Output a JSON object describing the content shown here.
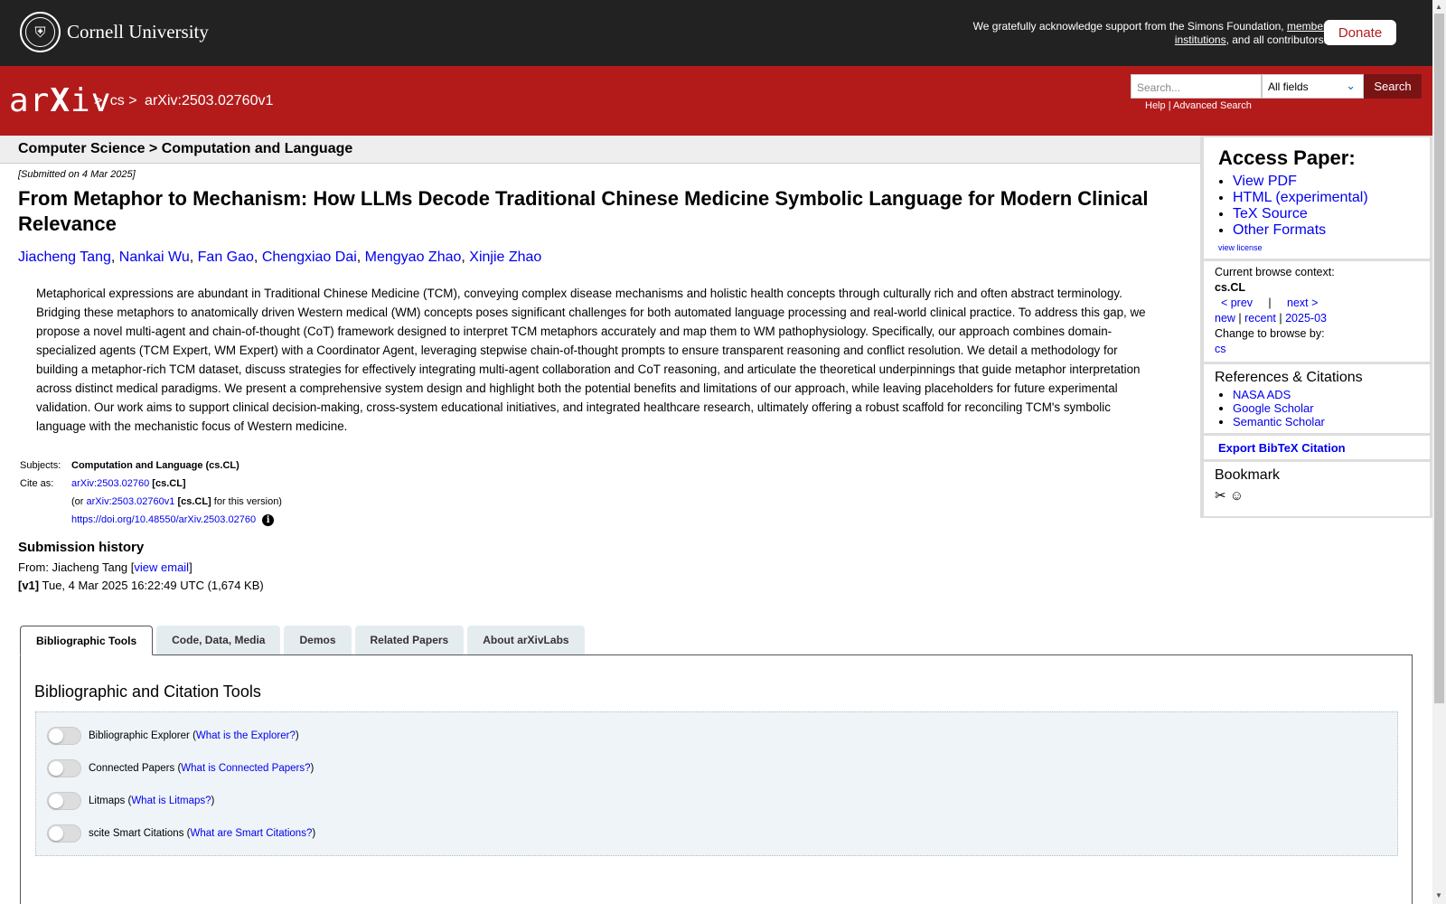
{
  "cornell": {
    "name": "Cornell University",
    "support_text": "We gratefully acknowledge support from the Simons Foundation,",
    "member_link": "member institutions",
    "support_tail": ", and all contributors.",
    "donate": "Donate"
  },
  "arxiv": {
    "logo_a": "ar",
    "logo_x": "X",
    "logo_b": "iv",
    "crumb_cs": "cs",
    "crumb_id": "arXiv:2503.02760v1",
    "sep": ">",
    "search_placeholder": "Search...",
    "search_field": "All fields",
    "search_btn": "Search",
    "help": "Help",
    "advanced": "Advanced Search",
    "pipe": "|"
  },
  "paper": {
    "subhead": "Computer Science > Computation and Language",
    "submitted": "[Submitted on 4 Mar 2025]",
    "title": "From Metaphor to Mechanism: How LLMs Decode Traditional Chinese Medicine Symbolic Language for Modern Clinical Relevance",
    "authors": [
      "Jiacheng Tang",
      "Nankai Wu",
      "Fan Gao",
      "Chengxiao Dai",
      "Mengyao Zhao",
      "Xinjie Zhao"
    ],
    "abstract": "Metaphorical expressions are abundant in Traditional Chinese Medicine (TCM), conveying complex disease mechanisms and holistic health concepts through culturally rich and often abstract terminology. Bridging these metaphors to anatomically driven Western medical (WM) concepts poses significant challenges for both automated language processing and real-world clinical practice. To address this gap, we propose a novel multi-agent and chain-of-thought (CoT) framework designed to interpret TCM metaphors accurately and map them to WM pathophysiology. Specifically, our approach combines domain-specialized agents (TCM Expert, WM Expert) with a Coordinator Agent, leveraging stepwise chain-of-thought prompts to ensure transparent reasoning and conflict resolution. We detail a methodology for building a metaphor-rich TCM dataset, discuss strategies for effectively integrating multi-agent collaboration and CoT reasoning, and articulate the theoretical underpinnings that guide metaphor interpretation across distinct medical paradigms. We present a comprehensive system design and highlight both the potential benefits and limitations of our approach, while leaving placeholders for future experimental validation. Our work aims to support clinical decision-making, cross-system educational initiatives, and integrated healthcare research, ultimately offering a robust scaffold for reconciling TCM's symbolic language with the mechanistic focus of Western medicine.",
    "subjects_label": "Subjects:",
    "subjects": "Computation and Language (cs.CL)",
    "cite_label": "Cite as:",
    "cite_id": "arXiv:2503.02760",
    "cite_cat": "[cs.CL]",
    "cite_or": "(or",
    "cite_vid": "arXiv:2503.02760v1",
    "cite_version": "for this version)",
    "doi": "https://doi.org/10.48550/arXiv.2503.02760",
    "history_title": "Submission history",
    "from_prefix": "From: Jiacheng Tang [",
    "view_email": "view email",
    "from_suffix": "]",
    "v1_tag": "[v1]",
    "v1_text": "Tue, 4 Mar 2025 16:22:49 UTC (1,674 KB)"
  },
  "tabs": [
    {
      "label": "Bibliographic Tools"
    },
    {
      "label": "Code, Data, Media"
    },
    {
      "label": "Demos"
    },
    {
      "label": "Related Papers"
    },
    {
      "label": "About arXivLabs"
    }
  ],
  "tools": {
    "title": "Bibliographic and Citation Tools",
    "items": [
      {
        "name": "Bibliographic Explorer",
        "link": "What is the Explorer?"
      },
      {
        "name": "Connected Papers",
        "link": "What is Connected Papers?"
      },
      {
        "name": "Litmaps",
        "link": "What is Litmaps?"
      },
      {
        "name": "scite Smart Citations",
        "link": "What are Smart Citations?"
      }
    ]
  },
  "sidebar": {
    "access_title": "Access Paper:",
    "access_links": [
      "View PDF",
      "HTML (experimental)",
      "TeX Source",
      "Other Formats"
    ],
    "view_license": "view license",
    "browse_ctx_label": "Current browse context:",
    "browse_ctx": "cs.CL",
    "prev": "< prev",
    "next": "next >",
    "new": "new",
    "recent": "recent",
    "month": "2025-03",
    "change_label": "Change to browse by:",
    "change_cs": "cs",
    "refs_title": "References & Citations",
    "refs": [
      "NASA ADS",
      "Google Scholar",
      "Semantic Scholar"
    ],
    "export": "Export BibTeX Citation",
    "bookmark": "Bookmark"
  }
}
